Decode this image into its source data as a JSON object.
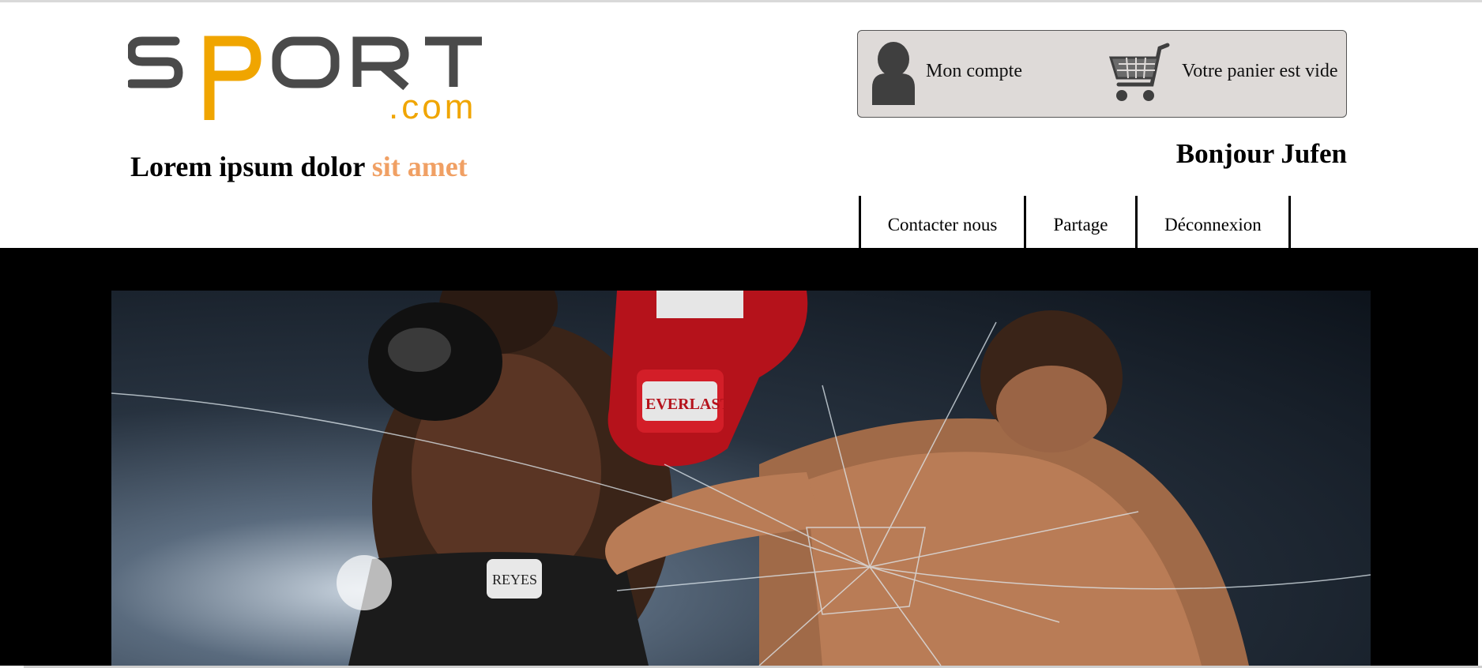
{
  "brand": {
    "logo_text": "SPORT",
    "logo_suffix": ".com",
    "colors": {
      "primary": "#4a4a4a",
      "accent": "#f0a500",
      "tagline_accent": "#f0a064"
    }
  },
  "tagline": {
    "main": "Lorem ipsum dolor ",
    "accent": "sit amet"
  },
  "account": {
    "icon": "user-icon",
    "label": "Mon compte"
  },
  "cart": {
    "icon": "shopping-cart-icon",
    "label": "Votre panier est vide"
  },
  "greeting": "Bonjour Jufen",
  "nav": {
    "items": [
      {
        "label": "Contacter nous"
      },
      {
        "label": "Partage"
      },
      {
        "label": "Déconnexion"
      }
    ]
  },
  "banner": {
    "image": "boxing-hero-image",
    "glove_text": "EVERLAST",
    "shorts_text": "REYES"
  }
}
